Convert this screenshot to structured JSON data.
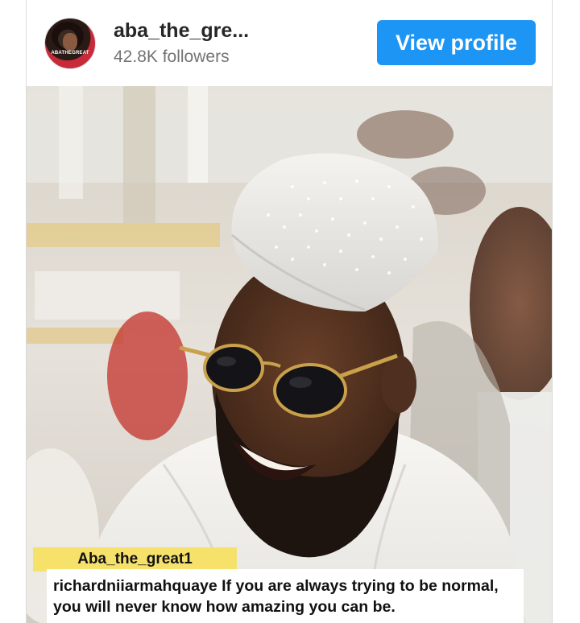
{
  "profile": {
    "username": "aba_the_gre...",
    "followers": "42.8K followers",
    "avatar_text": "ABATHEGREAT",
    "view_profile_label": "View profile"
  },
  "post": {
    "name_tag": "Aba_the_great1",
    "caption_handle": "richardniiarmahquaye",
    "caption_text": " If you are always trying to be normal, you will never know how amazing you can be."
  }
}
